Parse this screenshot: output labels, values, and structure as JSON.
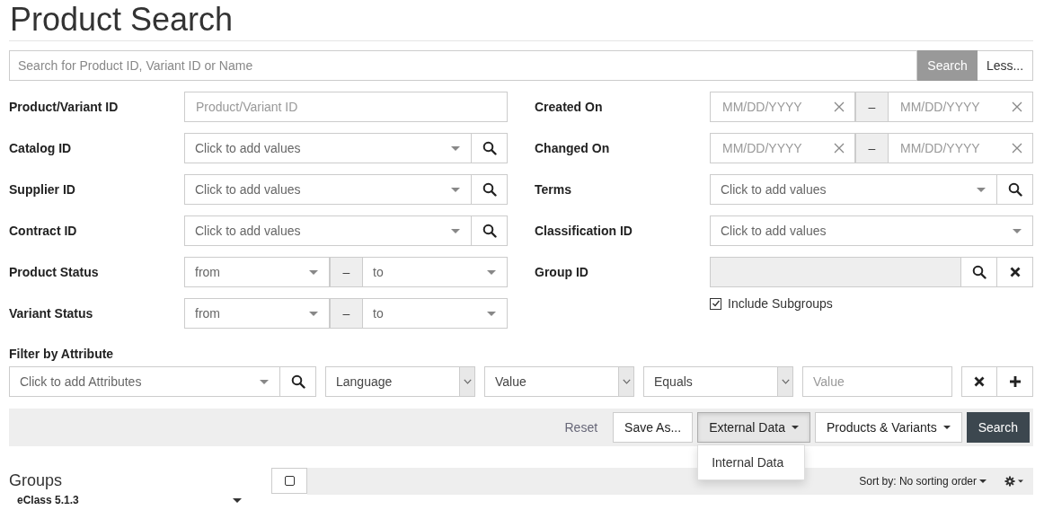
{
  "page": {
    "title": "Product Search"
  },
  "quick_search": {
    "placeholder": "Search for Product ID, Variant ID or Name",
    "search_button": "Search",
    "less_button": "Less..."
  },
  "left_fields": [
    {
      "kind": "text",
      "label": "Product/Variant ID",
      "placeholder": "Product/Variant ID"
    },
    {
      "kind": "select_search",
      "label": "Catalog ID",
      "placeholder": "Click to add values"
    },
    {
      "kind": "select_search",
      "label": "Supplier ID",
      "placeholder": "Click to add values"
    },
    {
      "kind": "select_search",
      "label": "Contract ID",
      "placeholder": "Click to add values"
    },
    {
      "kind": "range",
      "label": "Product Status",
      "from": "from",
      "separator": "–",
      "to": "to"
    },
    {
      "kind": "range",
      "label": "Variant Status",
      "from": "from",
      "separator": "–",
      "to": "to"
    }
  ],
  "right_fields": [
    {
      "kind": "date_range",
      "label": "Created On",
      "from_placeholder": "MM/DD/YYYY",
      "separator": "–",
      "to_placeholder": "MM/DD/YYYY"
    },
    {
      "kind": "date_range",
      "label": "Changed On",
      "from_placeholder": "MM/DD/YYYY",
      "separator": "–",
      "to_placeholder": "MM/DD/YYYY"
    },
    {
      "kind": "select_search",
      "label": "Terms",
      "placeholder": "Click to add values"
    },
    {
      "kind": "select",
      "label": "Classification ID",
      "placeholder": "Click to add values"
    },
    {
      "kind": "group",
      "label": "Group ID",
      "option": {
        "label": "Include Subgroups",
        "checked": true
      }
    }
  ],
  "attribute_filter": {
    "label": "Filter by Attribute",
    "attribute_placeholder": "Click to add Attributes",
    "selects": [
      "Language",
      "Value",
      "Equals"
    ],
    "value_placeholder": "Value"
  },
  "actions": [
    {
      "kind": "link",
      "label": "Reset"
    },
    {
      "kind": "button",
      "label": "Save As..."
    },
    {
      "kind": "dropdown",
      "label": "External Data",
      "expanded": true,
      "menu": [
        "Internal Data"
      ]
    },
    {
      "kind": "dropdown",
      "label": "Products & Variants",
      "expanded": false
    },
    {
      "kind": "primary",
      "label": "Search"
    }
  ],
  "groups": {
    "title": "Groups",
    "selector": "eClass 5.1.3"
  },
  "results_toolbar": {
    "select_all_checked": false,
    "sort": "Sort by: No sorting order"
  }
}
